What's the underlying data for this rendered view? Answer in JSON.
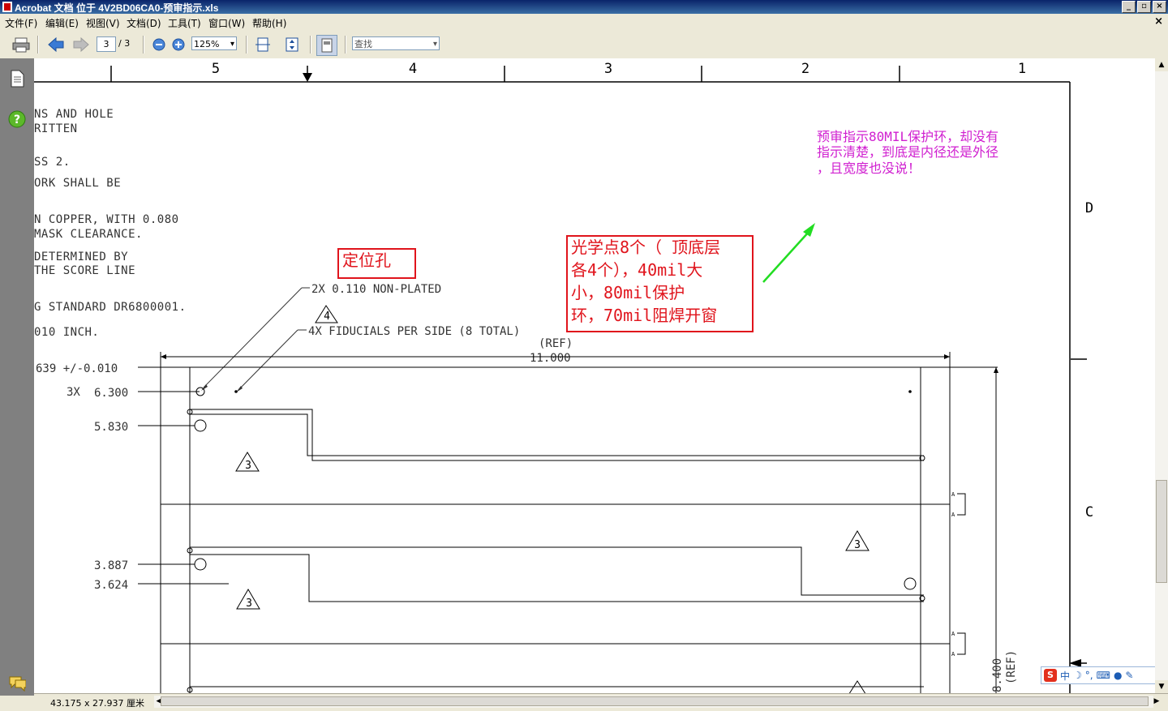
{
  "window": {
    "title": "Acrobat 文档 位于 4V2BD06CA0-预审指示.xls",
    "minimize_icon": "minimize-icon",
    "restore_icon": "restore-icon",
    "close_icon": "close-icon"
  },
  "menu": {
    "items": [
      "文件(F)",
      "编辑(E)",
      "视图(V)",
      "文档(D)",
      "工具(T)",
      "窗口(W)",
      "帮助(H)"
    ],
    "close_doc": "×"
  },
  "toolbar": {
    "page_current": "3",
    "page_total": "/ 3",
    "zoom": "125%",
    "find_placeholder": "查找"
  },
  "status": {
    "page_size": "43.175 x 27.937 厘米"
  },
  "drawing": {
    "zone_columns": [
      "5",
      "4",
      "3",
      "2",
      "1"
    ],
    "zone_rows": [
      "D",
      "C"
    ],
    "notes": [
      "NS AND HOLE",
      "RITTEN",
      "SS 2.",
      "ORK SHALL BE",
      "N COPPER, WITH 0.080",
      " MASK CLEARANCE.",
      "DETERMINED BY",
      " THE SCORE LINE",
      "G STANDARD DR6800001.",
      "010 INCH."
    ],
    "callout_holes": "2X 0.110 NON-PLATED",
    "callout_fiducials": "4X FIDUCIALS PER SIDE (8 TOTAL)",
    "dim_ref": "(REF)",
    "dim_width": "11.000",
    "dim_639": "639 +/-0.010",
    "dim_3x": "3X",
    "dim_6300": "6.300",
    "dim_5830": "5.830",
    "dim_3887": "3.887",
    "dim_3624": "3.624",
    "dim_height": "8.400",
    "dim_height_ref": "(REF)",
    "triangle_4": "4",
    "triangle_3": "3",
    "flag_a": "A"
  },
  "annotations": {
    "tooling_hole": "定位孔",
    "fiducials_lines": [
      "光学点8个（ 顶底层",
      "各4个），40mil大",
      "小，80mil保护",
      "环，70mil阻焊开窗"
    ],
    "note_lines": [
      "预审指示80MIL保护环，却没有",
      "指示清楚，到底是内径还是外径",
      "，且宽度也没说！"
    ]
  },
  "ime": {
    "logo": "S",
    "mode": "中",
    "punct": "°,"
  },
  "colors": {
    "annotation_red": "#e0141c",
    "annotation_magenta": "#d020d0",
    "arrow_green": "#22dd22",
    "titlebar": "#0a246a"
  }
}
